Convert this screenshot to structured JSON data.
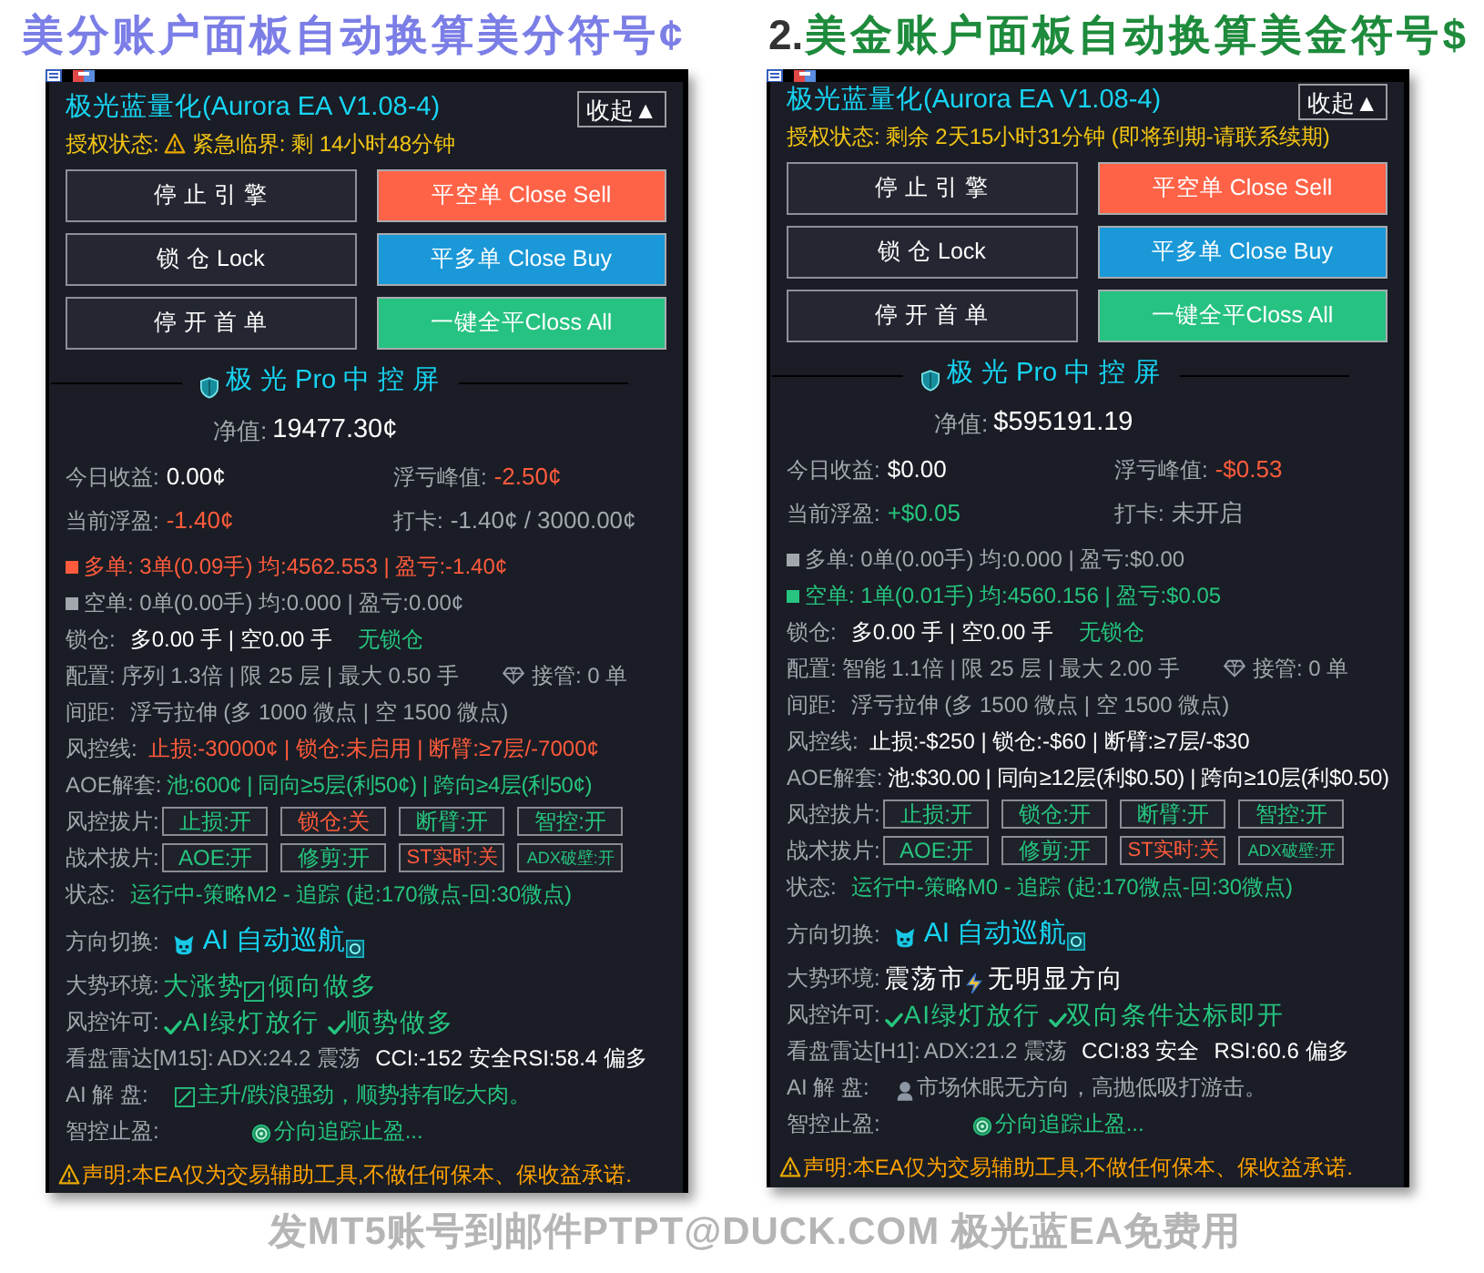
{
  "panels": [
    {
      "heading": {
        "text": "美分账户面板自动换算美分符号¢",
        "color": "#7b7ee6"
      },
      "title": "极光蓝量化(Aurora EA V1.08-4)",
      "collapse_button": "收起▲",
      "auth": {
        "label": "授权状态:",
        "warning": true,
        "text": "紧急临界: 剩 14小时48分钟"
      },
      "buttons": [
        {
          "label": "停 止 引 擎",
          "kind": "outline"
        },
        {
          "label": "平空单 Close Sell",
          "kind": "solid",
          "color": "#ff6347"
        },
        {
          "label": "锁 仓 Lock",
          "kind": "outline"
        },
        {
          "label": "平多单 Close Buy",
          "kind": "solid",
          "color": "#1a98d8"
        },
        {
          "label": "停 开 首 单",
          "kind": "outline"
        },
        {
          "label": "一键全平Closs All",
          "kind": "solid",
          "color": "#26c281"
        }
      ],
      "section_title": "极 光 Pro 中 控 屏",
      "equity": {
        "label": "净值:",
        "value": "19477.30¢"
      },
      "stats": [
        {
          "label": "今日收益:",
          "value": "0.00¢",
          "color": "#ffffff"
        },
        {
          "label": "浮亏峰值:",
          "value": "-2.50¢",
          "color": "#ff5b3c"
        },
        {
          "label": "当前浮盈:",
          "value": "-1.40¢",
          "color": "#ff5b3c"
        },
        {
          "label": "打卡:",
          "value": "-1.40¢ / 3000.00¢",
          "color": "#a2a6ad"
        }
      ],
      "positions": [
        {
          "text": "多单: 3单(0.09手) 均:4562.553 | 盈亏:-1.40¢",
          "color": "#ff5b3c"
        },
        {
          "text": "空单: 0单(0.00手) 均:0.000 | 盈亏:0.00¢",
          "color": "#a2a6ad"
        }
      ],
      "lock": {
        "label": "锁仓:",
        "value": "多0.00 手 | 空0.00 手",
        "status": "无锁仓"
      },
      "config": {
        "label": "配置:",
        "value": "序列 1.3倍 | 限 25 层 | 最大 0.50 手",
        "takeover": "接管: 0 单"
      },
      "spacing": {
        "label": "间距:",
        "value": "浮亏拉伸 (多 1000 微点 | 空 1500 微点)"
      },
      "risk_line": {
        "label": "风控线:",
        "value": "止损:-30000¢ | 锁仓:未启用 | 断臂:≥7层/-7000¢",
        "color": "#ff5b3c"
      },
      "aoe": {
        "label": "AOE解套:",
        "value": "池:600¢ | 同向≥5层(利50¢) | 跨向≥4层(利50¢)",
        "color": "#26c47f"
      },
      "switch_rows": [
        {
          "label": "风控拔片:",
          "items": [
            {
              "text": "止损:开",
              "on": true
            },
            {
              "text": "锁仓:关",
              "on": false
            },
            {
              "text": "断臂:开",
              "on": true
            },
            {
              "text": "智控:开",
              "on": true
            }
          ]
        },
        {
          "label": "战术拔片:",
          "items": [
            {
              "text": "AOE:开",
              "on": true
            },
            {
              "text": "修剪:开",
              "on": true
            },
            {
              "text": "ST实时:关",
              "on": false
            },
            {
              "text": "ADX破壁:开",
              "on": true
            }
          ]
        }
      ],
      "status": {
        "label": "状态:",
        "value": "运行中-策略M2 - 追踪 (起:170微点-回:30微点)"
      },
      "direction": {
        "label": "方向切换:",
        "value": "AI 自动巡航"
      },
      "trend": {
        "label": "大势环境:",
        "kind": "bullish",
        "parts": [
          "大涨势",
          "倾向做多"
        ],
        "color": "#26c47f"
      },
      "permission": {
        "label": "风控许可:",
        "items": [
          "AI绿灯放行",
          "顺势做多"
        ]
      },
      "radar": {
        "label": "看盘雷达[M15]:",
        "parts": [
          {
            "text": "ADX:24.2 震荡",
            "color": "#a2a6ad"
          },
          {
            "text": "CCI:-152 安全RSI:58.4 偏多",
            "color": "#ffffff"
          }
        ]
      },
      "ai_reading": {
        "label": "AI 解 盘:",
        "kind": "bullish",
        "text": "主升/跌浪强劲，顺势持有吃大肉。",
        "color": "#26c47f"
      },
      "take_profit": {
        "label": "智控止盈:",
        "text": "分向追踪止盈..."
      },
      "disclaimer": "声明:本EA仅为交易辅助工具,不做任何保本、保收益承诺."
    },
    {
      "heading": {
        "number": "2.",
        "text": "美金账户面板自动换算美金符号$",
        "color": "#1e8b3c"
      },
      "title": "极光蓝量化(Aurora EA V1.08-4)",
      "collapse_button": "收起▲",
      "auth": {
        "label": "授权状态:",
        "warning": false,
        "text": "剩余 2天15小时31分钟 (即将到期-请联系续期)"
      },
      "buttons": [
        {
          "label": "停 止 引 擎",
          "kind": "outline"
        },
        {
          "label": "平空单 Close Sell",
          "kind": "solid",
          "color": "#ff6347"
        },
        {
          "label": "锁 仓 Lock",
          "kind": "outline"
        },
        {
          "label": "平多单 Close Buy",
          "kind": "solid",
          "color": "#1a98d8"
        },
        {
          "label": "停 开 首 单",
          "kind": "outline"
        },
        {
          "label": "一键全平Closs All",
          "kind": "solid",
          "color": "#26c281"
        }
      ],
      "section_title": "极 光 Pro 中 控 屏",
      "equity": {
        "label": "净值:",
        "value": "$595191.19"
      },
      "stats": [
        {
          "label": "今日收益:",
          "value": "$0.00",
          "color": "#ffffff"
        },
        {
          "label": "浮亏峰值:",
          "value": "-$0.53",
          "color": "#ff5b3c"
        },
        {
          "label": "当前浮盈:",
          "value": "+$0.05",
          "color": "#26c47f"
        },
        {
          "label": "打卡:",
          "value": "未开启",
          "color": "#a2a6ad"
        }
      ],
      "positions": [
        {
          "text": "多单: 0单(0.00手) 均:0.000 | 盈亏:$0.00",
          "color": "#a2a6ad"
        },
        {
          "text": "空单: 1单(0.01手) 均:4560.156 | 盈亏:$0.05",
          "color": "#26c47f"
        }
      ],
      "lock": {
        "label": "锁仓:",
        "value": "多0.00 手 | 空0.00 手",
        "status": "无锁仓"
      },
      "config": {
        "label": "配置:",
        "value": "智能 1.1倍 | 限 25 层 | 最大 2.00 手",
        "takeover": "接管: 0 单"
      },
      "spacing": {
        "label": "间距:",
        "value": "浮亏拉伸 (多 1500 微点 | 空 1500 微点)"
      },
      "risk_line": {
        "label": "风控线:",
        "value": "止损:-$250 | 锁仓:-$60 | 断臂:≥7层/-$30",
        "color": "#ffffff"
      },
      "aoe": {
        "label": "AOE解套:",
        "value": "池:$30.00 | 同向≥12层(利$0.50) | 跨向≥10层(利$0.50)",
        "color": "#ffffff"
      },
      "switch_rows": [
        {
          "label": "风控拔片:",
          "items": [
            {
              "text": "止损:开",
              "on": true
            },
            {
              "text": "锁仓:开",
              "on": true
            },
            {
              "text": "断臂:开",
              "on": true
            },
            {
              "text": "智控:开",
              "on": true
            }
          ]
        },
        {
          "label": "战术拔片:",
          "items": [
            {
              "text": "AOE:开",
              "on": true
            },
            {
              "text": "修剪:开",
              "on": true
            },
            {
              "text": "ST实时:关",
              "on": false
            },
            {
              "text": "ADX破壁:开",
              "on": true
            }
          ]
        }
      ],
      "status": {
        "label": "状态:",
        "value": "运行中-策略M0 - 追踪 (起:170微点-回:30微点)"
      },
      "direction": {
        "label": "方向切换:",
        "value": "AI 自动巡航"
      },
      "trend": {
        "label": "大势环境:",
        "kind": "ranging",
        "parts": [
          "震荡市",
          "无明显方向"
        ],
        "color": "#ffffff"
      },
      "permission": {
        "label": "风控许可:",
        "items": [
          "AI绿灯放行",
          "双向条件达标即开"
        ]
      },
      "radar": {
        "label": "看盘雷达[H1]:",
        "parts": [
          {
            "text": "ADX:21.2 震荡",
            "color": "#a2a6ad"
          },
          {
            "text": "CCI:83 安全",
            "color": "#ffffff"
          },
          {
            "text": "RSI:60.6 偏多",
            "color": "#ffffff"
          }
        ]
      },
      "ai_reading": {
        "label": "AI 解 盘:",
        "kind": "ranging",
        "text": "市场休眠无方向，高抛低吸打游击。",
        "color": "#a2a6ad"
      },
      "take_profit": {
        "label": "智控止盈:",
        "text": "分向追踪止盈..."
      },
      "disclaimer": "声明:本EA仅为交易辅助工具,不做任何保本、保收益承诺."
    }
  ],
  "caption": "发MT5账号到邮件PTPT@DUCK.COM 极光蓝EA免费用"
}
